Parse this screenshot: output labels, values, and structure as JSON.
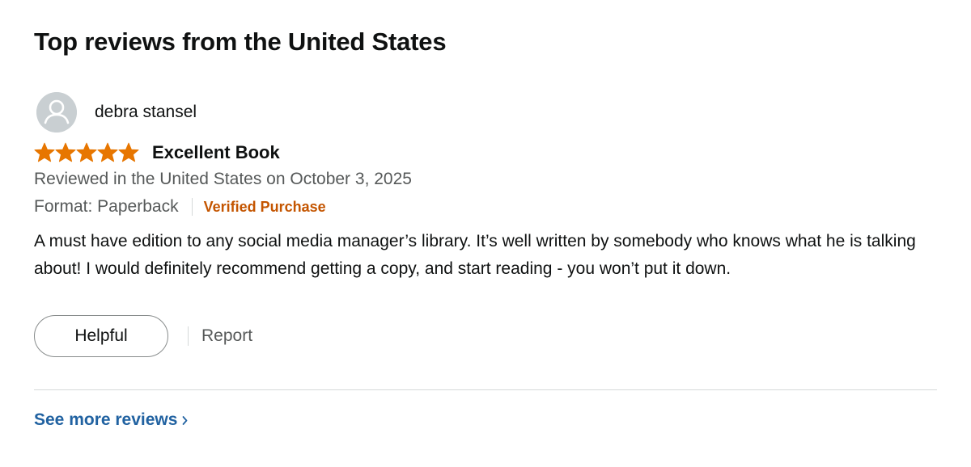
{
  "section": {
    "title": "Top reviews from the United States"
  },
  "review": {
    "reviewer_name": "debra stansel",
    "avatar_icon": "default-user-avatar-icon",
    "rating": 5,
    "rating_max": 5,
    "star_icon": "star-icon",
    "title": "Excellent Book",
    "date_text": "Reviewed in the United States on October 3, 2025",
    "format_text": "Format: Paperback",
    "verified_text": "Verified Purchase",
    "body": "A must have edition to any social media manager’s library. It’s well written by somebody who knows what he is talking about! I would definitely recommend getting a copy, and start reading - you won’t put it down.",
    "helpful_label": "Helpful",
    "report_label": "Report"
  },
  "footer": {
    "see_more_label": "See more reviews",
    "chevron_icon": "chevron-right-icon"
  },
  "colors": {
    "star": "#e77600",
    "verified": "#c45500",
    "link": "#2162a1",
    "secondary_text": "#565959",
    "divider": "#d5d9d9"
  }
}
